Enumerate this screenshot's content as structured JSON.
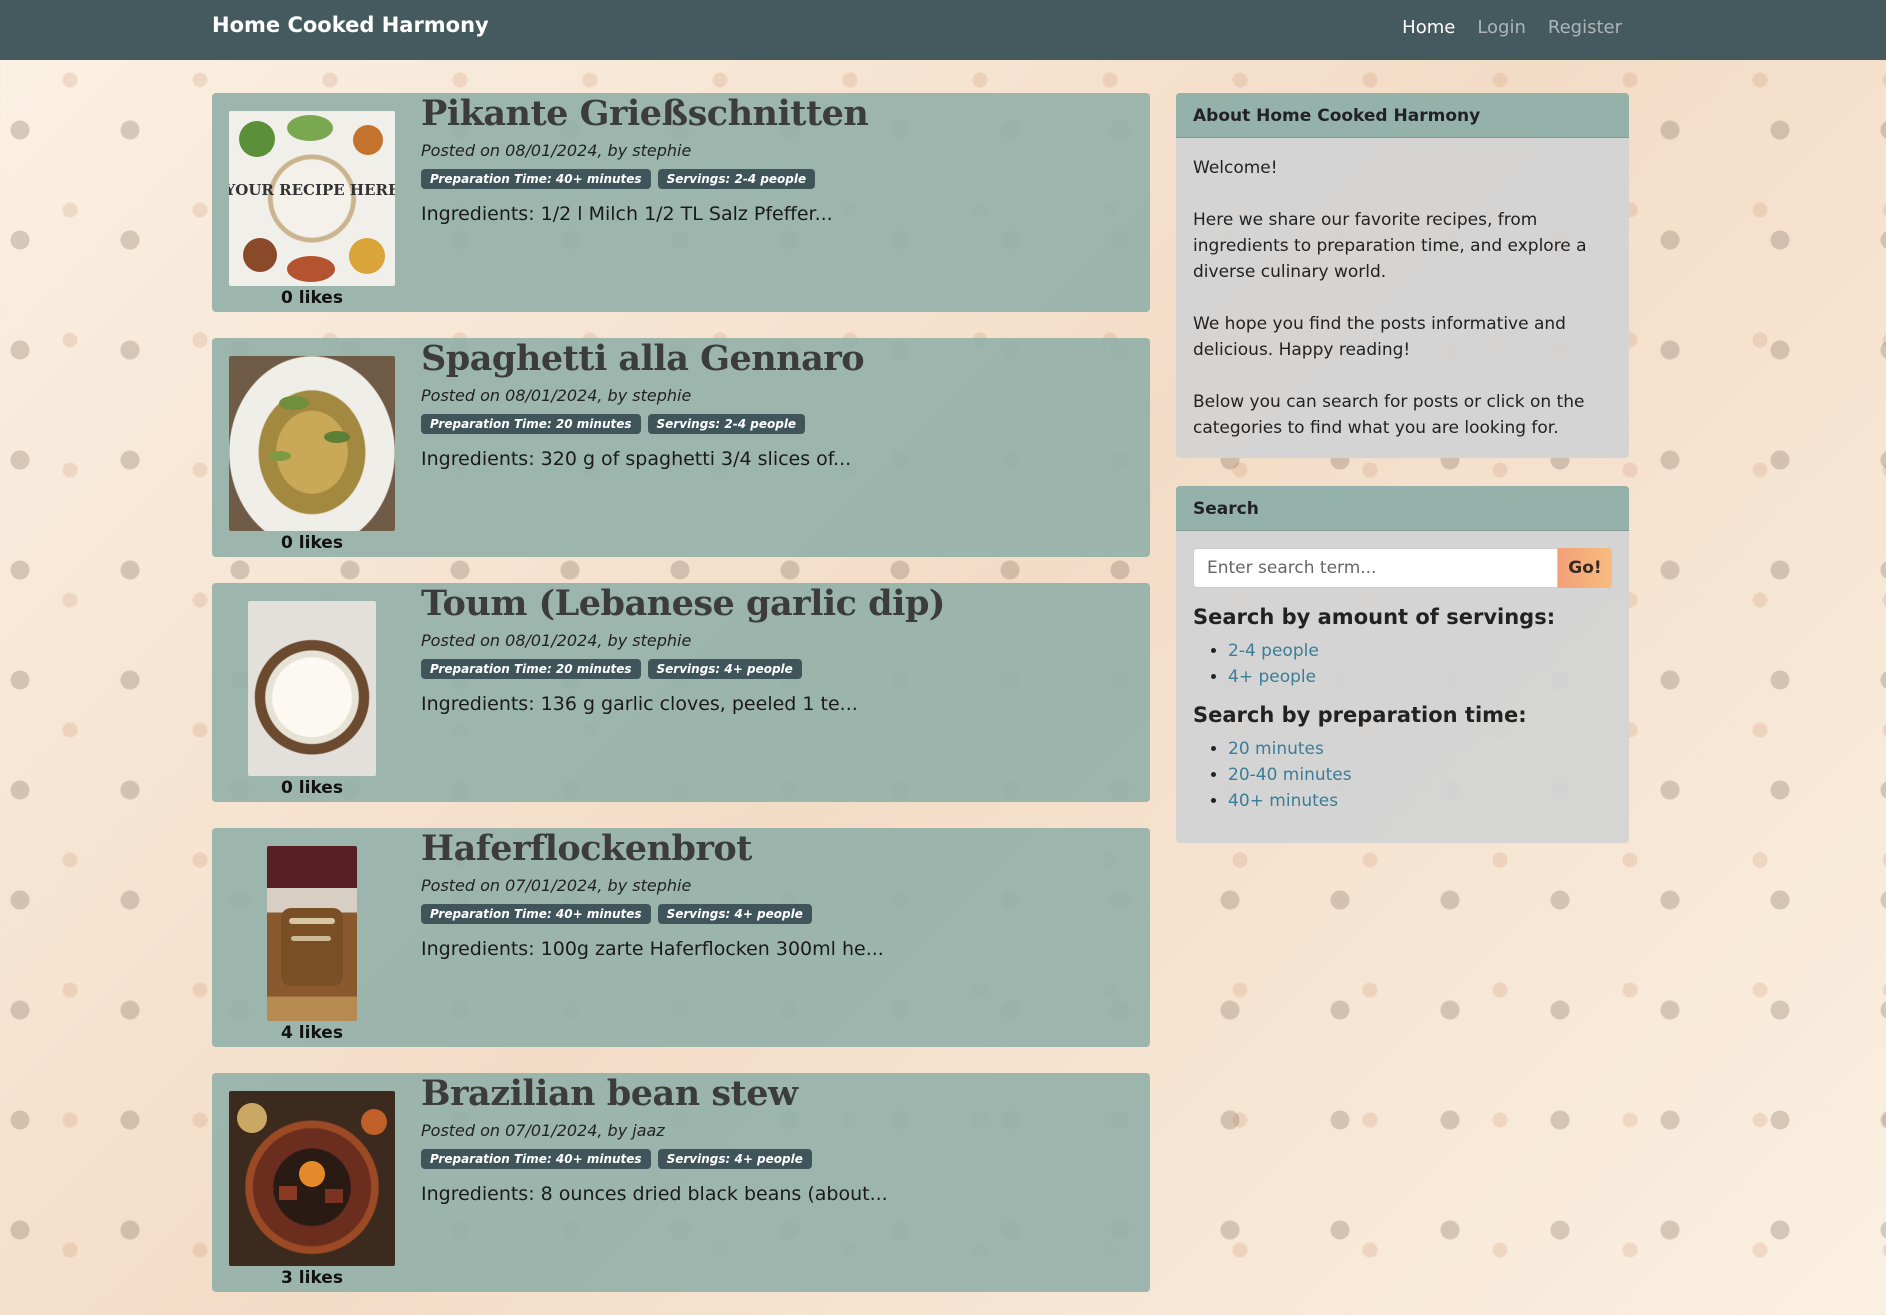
{
  "navbar": {
    "brand": "Home Cooked Harmony",
    "links": [
      {
        "label": "Home",
        "active": true
      },
      {
        "label": "Login",
        "active": false
      },
      {
        "label": "Register",
        "active": false
      }
    ]
  },
  "posts": [
    {
      "title": "Pikante Grießschnitten",
      "meta": "Posted on 08/01/2024, by stephie",
      "badges": [
        "Preparation Time: 40+ minutes",
        "Servings: 2-4 people"
      ],
      "ingredients": "Ingredients: 1/2 l Milch 1/2 TL Salz Pfeffer...",
      "likes": "0 likes",
      "image_label": "YOUR RECIPE HERE"
    },
    {
      "title": "Spaghetti alla Gennaro",
      "meta": "Posted on 08/01/2024, by stephie",
      "badges": [
        "Preparation Time: 20 minutes",
        "Servings: 2-4 people"
      ],
      "ingredients": "Ingredients: 320 g of spaghetti 3/4 slices of...",
      "likes": "0 likes"
    },
    {
      "title": "Toum (Lebanese garlic dip)",
      "meta": "Posted on 08/01/2024, by stephie",
      "badges": [
        "Preparation Time: 20 minutes",
        "Servings: 4+ people"
      ],
      "ingredients": "Ingredients: 136 g garlic cloves, peeled 1 te...",
      "likes": "0 likes"
    },
    {
      "title": "Haferflockenbrot",
      "meta": "Posted on 07/01/2024, by stephie",
      "badges": [
        "Preparation Time: 40+ minutes",
        "Servings: 4+ people"
      ],
      "ingredients": "Ingredients: 100g zarte Haferflocken 300ml he...",
      "likes": "4 likes"
    },
    {
      "title": "Brazilian bean stew",
      "meta": "Posted on 07/01/2024, by jaaz",
      "badges": [
        "Preparation Time: 40+ minutes",
        "Servings: 4+ people"
      ],
      "ingredients": "Ingredients: 8 ounces dried black beans (about...",
      "likes": "3 likes"
    }
  ],
  "about": {
    "header": "About Home Cooked Harmony",
    "paragraphs": [
      "Welcome!",
      "Here we share our favorite recipes, from ingredients to preparation time, and explore a diverse culinary world.",
      "We hope you find the posts informative and delicious. Happy reading!",
      "Below you can search for posts or click on the categories to find what you are looking for."
    ]
  },
  "search": {
    "header": "Search",
    "placeholder": "Enter search term...",
    "button": "Go!",
    "servings_heading": "Search by amount of servings:",
    "servings": [
      "2-4 people",
      "4+ people"
    ],
    "time_heading": "Search by preparation time:",
    "times": [
      "20 minutes",
      "20-40 minutes",
      "40+ minutes"
    ]
  },
  "colors": {
    "navbar": "#455a5f",
    "post_card": "#94b1aa",
    "badge": "#3f555a",
    "link": "#3a7d96",
    "go_button": "#f4a07a"
  }
}
